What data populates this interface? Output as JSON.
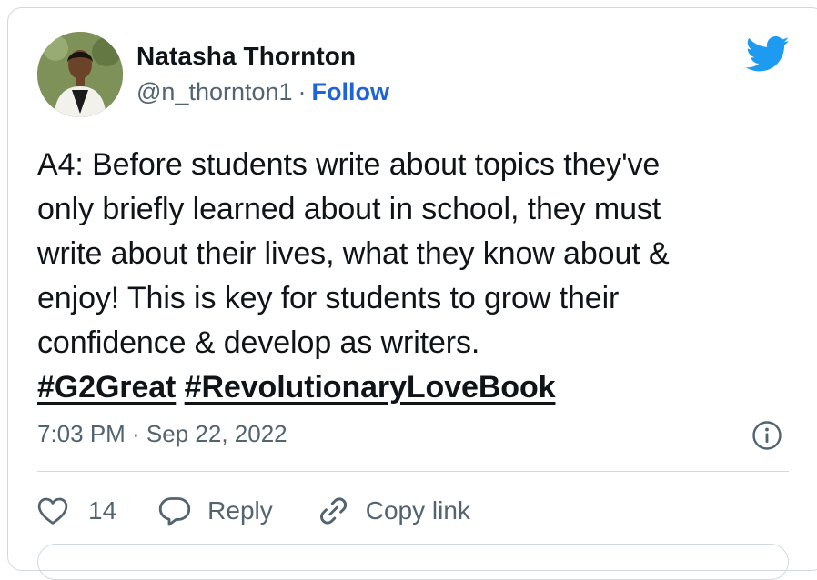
{
  "author": {
    "name": "Natasha Thornton",
    "handle": "@n_thornton1",
    "separator": "·",
    "follow_label": "Follow"
  },
  "tweet": {
    "lines": [
      "A4: Before students write about topics they've",
      "only briefly learned about in school, they must",
      "write about their lives, what they know about &",
      "enjoy! This is key for students to grow their",
      "confidence & develop as writers."
    ],
    "hashtags": [
      "#G2Great",
      "#RevolutionaryLoveBook"
    ]
  },
  "meta": {
    "timestamp": "7:03 PM · Sep 22, 2022"
  },
  "actions": {
    "like_count": "14",
    "reply_label": "Reply",
    "copy_link_label": "Copy link"
  },
  "icons": {
    "brand": "twitter-bird-icon",
    "info": "info-icon",
    "like": "heart-icon",
    "reply": "speech-bubble-icon",
    "copy": "link-icon"
  },
  "colors": {
    "twitter_blue": "#1d9bf0",
    "follow_blue": "#1d64d8",
    "text_primary": "#0f1419",
    "text_secondary": "#536471",
    "border": "#cfd9de"
  }
}
